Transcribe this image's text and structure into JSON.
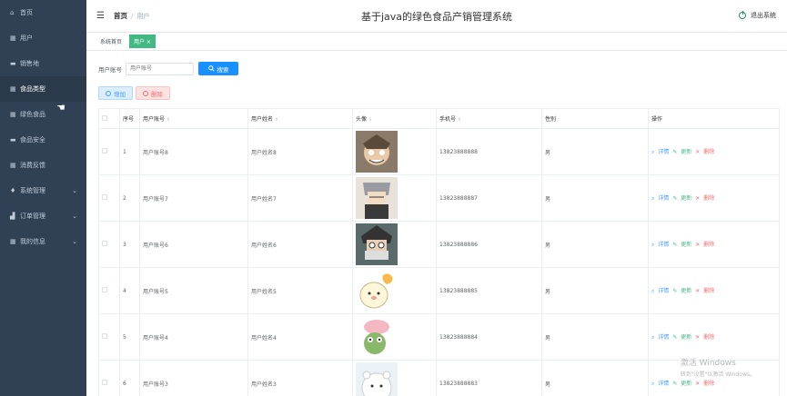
{
  "sidebar": {
    "items": [
      {
        "label": "首页",
        "icon": "home-icon",
        "glyph": "⌂",
        "chev": ""
      },
      {
        "label": "用户",
        "icon": "grid-icon",
        "glyph": "▦",
        "chev": ""
      },
      {
        "label": "销售地",
        "icon": "chat-icon",
        "glyph": "▬",
        "chev": ""
      },
      {
        "label": "食品类型",
        "icon": "grid-icon",
        "glyph": "▦",
        "chev": ""
      },
      {
        "label": "绿色食品",
        "icon": "grid-icon",
        "glyph": "▦",
        "chev": ""
      },
      {
        "label": "食品安全",
        "icon": "chat-icon",
        "glyph": "▬",
        "chev": ""
      },
      {
        "label": "消费反馈",
        "icon": "grid-icon",
        "glyph": "▦",
        "chev": ""
      },
      {
        "label": "系统管理",
        "icon": "location-icon",
        "glyph": "♦",
        "chev": "⌄"
      },
      {
        "label": "订单管理",
        "icon": "chart-icon",
        "glyph": "▟",
        "chev": "⌄"
      },
      {
        "label": "我的信息",
        "icon": "grid-icon",
        "glyph": "▦",
        "chev": "⌄"
      }
    ]
  },
  "header": {
    "breadcrumb_home": "首页",
    "breadcrumb_sep": "/",
    "breadcrumb_current": "用户",
    "title": "基于java的绿色食品产销管理系统",
    "logout": "退出系统"
  },
  "tags": {
    "home": "系统首页",
    "current": "用户 ×"
  },
  "search": {
    "label": "用户账号",
    "placeholder": "用户账号",
    "button": "搜索"
  },
  "actions": {
    "add": "增加",
    "delete": "删除"
  },
  "table": {
    "headers": {
      "index": "序号",
      "account": "用户账号",
      "name": "用户姓名",
      "avatar": "头像",
      "phone": "手机号",
      "gender": "性别",
      "ops": "操作"
    },
    "op_labels": {
      "detail": "详情",
      "edit": "更新",
      "delete": "删除"
    },
    "rows": [
      {
        "index": "1",
        "account": "用户账号8",
        "name": "用户姓名8",
        "phone": "13823888888",
        "gender": "男"
      },
      {
        "index": "2",
        "account": "用户账号7",
        "name": "用户姓名7",
        "phone": "13823888887",
        "gender": "男"
      },
      {
        "index": "3",
        "account": "用户账号6",
        "name": "用户姓名6",
        "phone": "13823888886",
        "gender": "男"
      },
      {
        "index": "4",
        "account": "用户账号5",
        "name": "用户姓名5",
        "phone": "13823888885",
        "gender": "男"
      },
      {
        "index": "5",
        "account": "用户账号4",
        "name": "用户姓名4",
        "phone": "13823888884",
        "gender": "男"
      },
      {
        "index": "6",
        "account": "用户账号3",
        "name": "用户姓名3",
        "phone": "13823888883",
        "gender": "男"
      }
    ]
  },
  "watermark": {
    "line1": "激活 Windows",
    "line2": "转到\"设置\"以激活 Windows。"
  },
  "colors": {
    "sidebar_bg": "#304156",
    "accent_green": "#42b983",
    "primary_blue": "#1890ff",
    "danger": "#f56c6c"
  }
}
